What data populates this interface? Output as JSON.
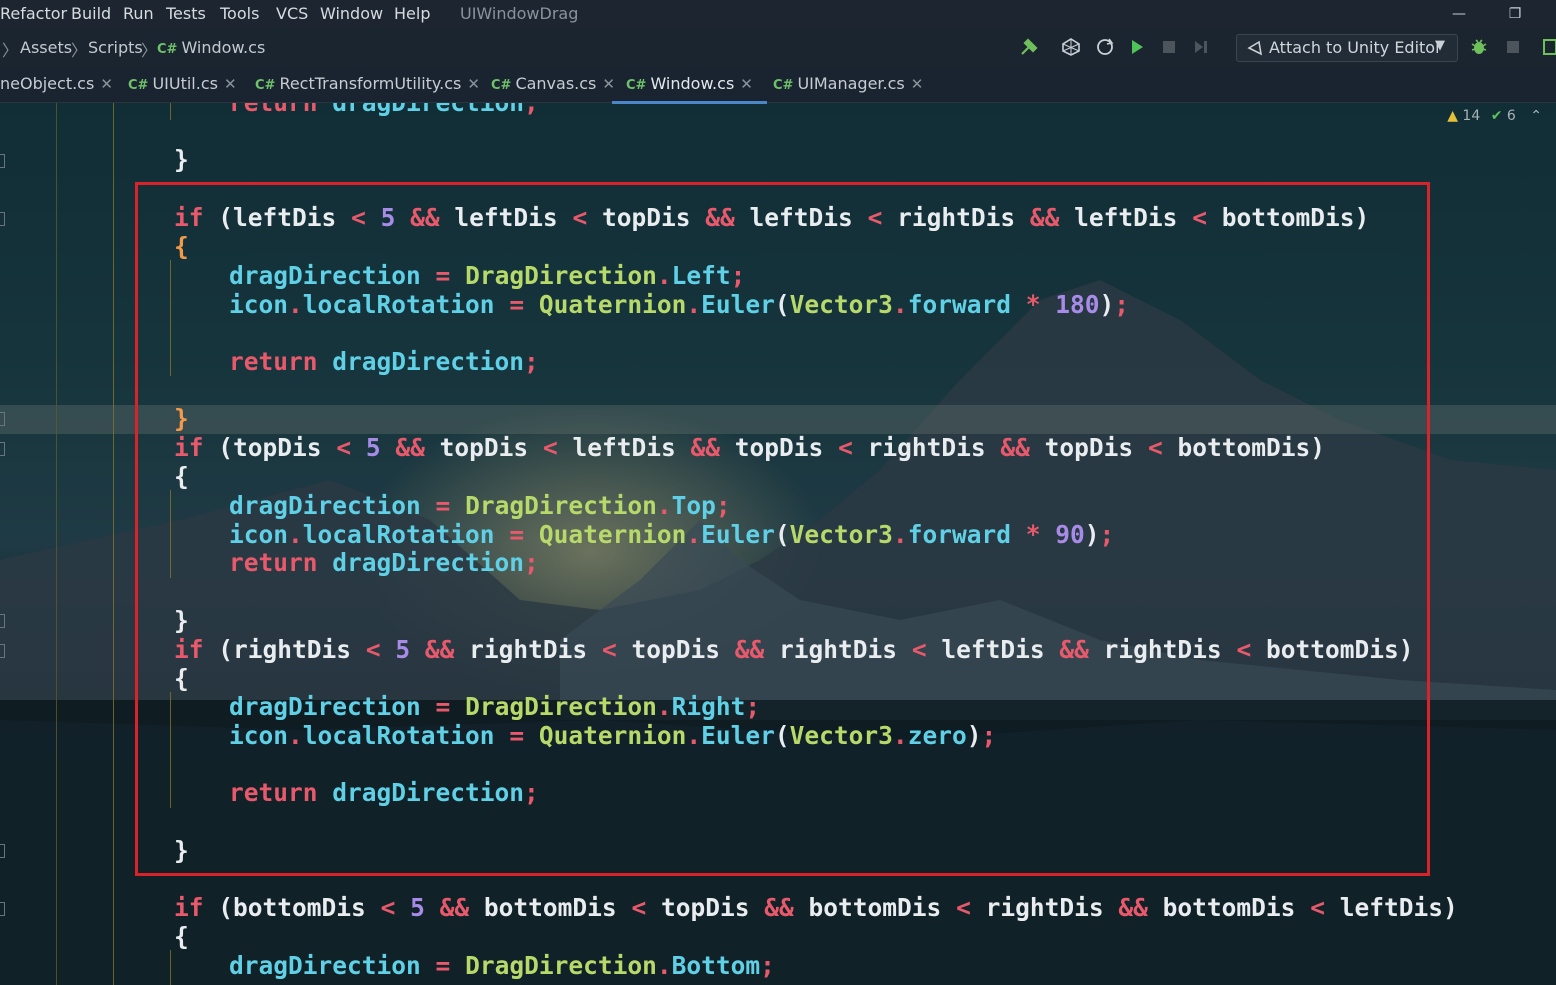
{
  "menu": {
    "items": [
      "Refactor",
      "Build",
      "Run",
      "Tests",
      "Tools",
      "VCS",
      "Window",
      "Help"
    ],
    "window_title": "UIWindowDrag"
  },
  "breadcrumb": {
    "items": [
      "Assets",
      "Scripts",
      "Window.cs"
    ],
    "file_badge": "C#"
  },
  "toolbar": {
    "attach_label": "Attach to Unity Editor"
  },
  "tabs": [
    {
      "label": "neObject.cs",
      "badge": "",
      "active": false
    },
    {
      "label": "UIUtil.cs",
      "badge": "C#",
      "active": false
    },
    {
      "label": "RectTransformUtility.cs",
      "badge": "C#",
      "active": false
    },
    {
      "label": "Canvas.cs",
      "badge": "C#",
      "active": false
    },
    {
      "label": "Window.cs",
      "badge": "C#",
      "active": true
    },
    {
      "label": "UIManager.cs",
      "badge": "C#",
      "active": false
    }
  ],
  "inspections": {
    "warnings": "14",
    "ok": "6"
  },
  "code": {
    "lines": [
      "        return dragDirection;",
      "",
      "    }",
      "",
      "    if (leftDis < 5 && leftDis < topDis && leftDis < rightDis && leftDis < bottomDis)",
      "    {",
      "        dragDirection = DragDirection.Left;",
      "        icon.localRotation = Quaternion.Euler(Vector3.forward * 180);",
      "",
      "        return dragDirection;",
      "",
      "    }",
      "    if (topDis < 5 && topDis < leftDis && topDis < rightDis && topDis < bottomDis)",
      "    {",
      "        dragDirection = DragDirection.Top;",
      "        icon.localRotation = Quaternion.Euler(Vector3.forward * 90);",
      "        return dragDirection;",
      "",
      "    }",
      "    if (rightDis < 5 && rightDis < topDis && rightDis < leftDis && rightDis < bottomDis)",
      "    {",
      "        dragDirection = DragDirection.Right;",
      "        icon.localRotation = Quaternion.Euler(Vector3.zero);",
      "",
      "        return dragDirection;",
      "",
      "    }",
      "",
      "    if (bottomDis < 5 && bottomDis < topDis && bottomDis < rightDis && bottomDis < leftDis)",
      "    {",
      "        dragDirection = DragDirection.Bottom;"
    ]
  },
  "colors": {
    "keyword": "#e8596b",
    "field": "#5fd0e6",
    "type": "#b7d96a",
    "number": "#a88be8",
    "identifier": "#e9edf0",
    "highlight_border": "#d8232a",
    "accent": "#4a86c8"
  },
  "icons": [
    "build-hammer-icon",
    "unity-icon",
    "refresh-icon",
    "run-icon",
    "stop-icon",
    "step-icon",
    "unity-attach-icon",
    "dropdown-icon",
    "debug-bug-icon",
    "stop-icon-2",
    "warning-icon",
    "check-icon",
    "collapse-icon",
    "close-icon",
    "restore-window-icon",
    "minimize-icon"
  ]
}
